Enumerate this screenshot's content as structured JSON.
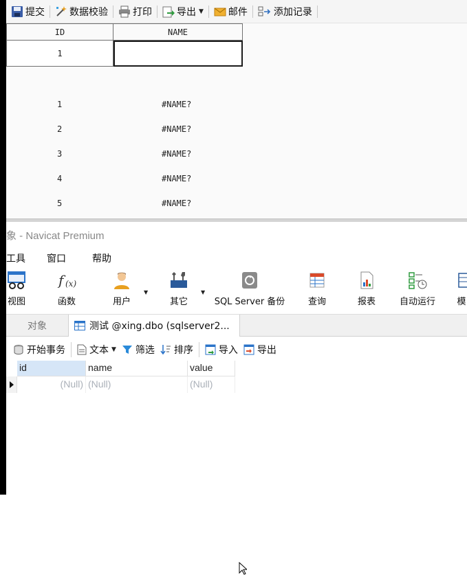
{
  "designer_toolbar": {
    "submit": "提交",
    "validate": "数据校验",
    "print": "打印",
    "export": "导出",
    "mail": "邮件",
    "add_record": "添加记录"
  },
  "designer_grid": {
    "headers": [
      "ID",
      "NAME"
    ],
    "row": [
      "1",
      ""
    ]
  },
  "preview_rows": [
    {
      "id": "1",
      "name": "#NAME?"
    },
    {
      "id": "2",
      "name": "#NAME?"
    },
    {
      "id": "3",
      "name": "#NAME?"
    },
    {
      "id": "4",
      "name": "#NAME?"
    },
    {
      "id": "5",
      "name": "#NAME?"
    }
  ],
  "navicat": {
    "title": "象 - Navicat Premium",
    "menu": [
      "工具",
      "窗口",
      "帮助"
    ],
    "ribbon": [
      "视图",
      "函数",
      "用户",
      "其它",
      "SQL Server 备份",
      "查询",
      "报表",
      "自动运行",
      "模"
    ],
    "tabs": {
      "objects": "对象",
      "active": "测试 @xing.dbo (sqlserver2..."
    },
    "toolbar": {
      "begin_tx": "开始事务",
      "text": "文本",
      "filter": "筛选",
      "sort": "排序",
      "import": "导入",
      "export": "导出"
    },
    "grid": {
      "columns": [
        "id",
        "name",
        "value"
      ],
      "row": [
        "(Null)",
        "(Null)",
        "(Null)"
      ]
    }
  },
  "colors": {
    "accent_blue": "#2a73c9",
    "null_text": "#aab0b8",
    "selected_header": "#d6e6f7"
  }
}
